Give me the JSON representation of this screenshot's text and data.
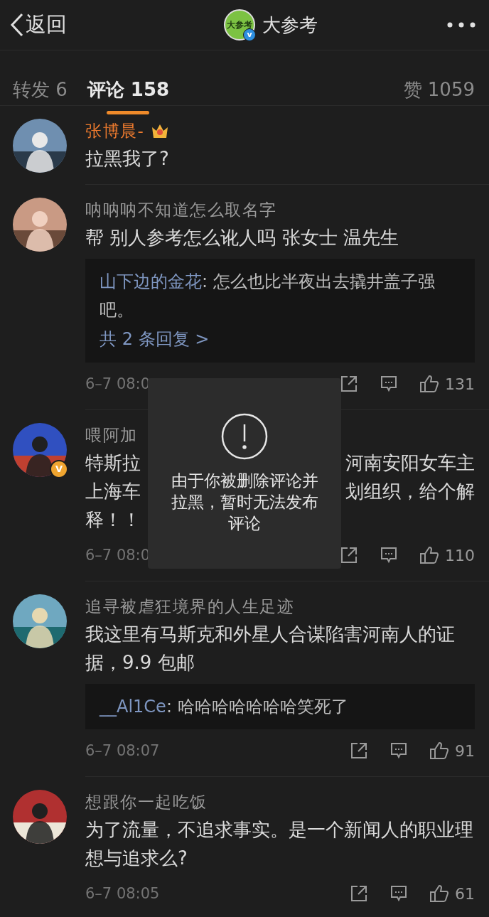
{
  "header": {
    "back_label": "返回",
    "logo_text": "大参考",
    "logo_badge": "v",
    "title": "大参考"
  },
  "tabs": [
    {
      "label": "转发 6",
      "selected": false
    },
    {
      "label": "评论 158",
      "selected": true
    }
  ],
  "likes_tab": "赞 1059",
  "comments": [
    {
      "author": "张博晨-",
      "vip": true,
      "text": "拉黑我了?"
    },
    {
      "author": "呐呐呐不知道怎么取名字",
      "vip": false,
      "text": "帮 别人参考怎么讹人吗  张女士 温先生",
      "reply": {
        "author": "山下边的金花",
        "text": ": 怎么也比半夜出去撬井盖子强吧。",
        "more": "共 2 条回复 >"
      },
      "time": "6–7 08:0",
      "likes": "131"
    },
    {
      "author": "喂阿加",
      "vip": false,
      "badge": "V",
      "text_lines": [
        [
          "特斯拉",
          "河南安阳女车主"
        ],
        [
          "上海车",
          "划组织，给个解"
        ],
        [
          "释！！"
        ]
      ],
      "time": "6–7 08:0",
      "likes": "110"
    },
    {
      "author": "追寻被虐狂境界的人生足迹",
      "vip": false,
      "text": "我这里有马斯克和外星人合谋陷害河南人的证据，9.9 包邮",
      "reply": {
        "author": "__Al1Ce",
        "text": ": 哈哈哈哈哈哈哈笑死了"
      },
      "time": "6–7 08:07",
      "likes": "91"
    },
    {
      "author": "想跟你一起吃饭",
      "vip": false,
      "text": "为了流量，不追求事实。是一个新闻人的职业理想与追求么?",
      "time": "6–7 08:05",
      "likes": "61"
    }
  ],
  "toast": {
    "message": "由于你被删除评论并拉黑，暂时无法发布评论"
  }
}
